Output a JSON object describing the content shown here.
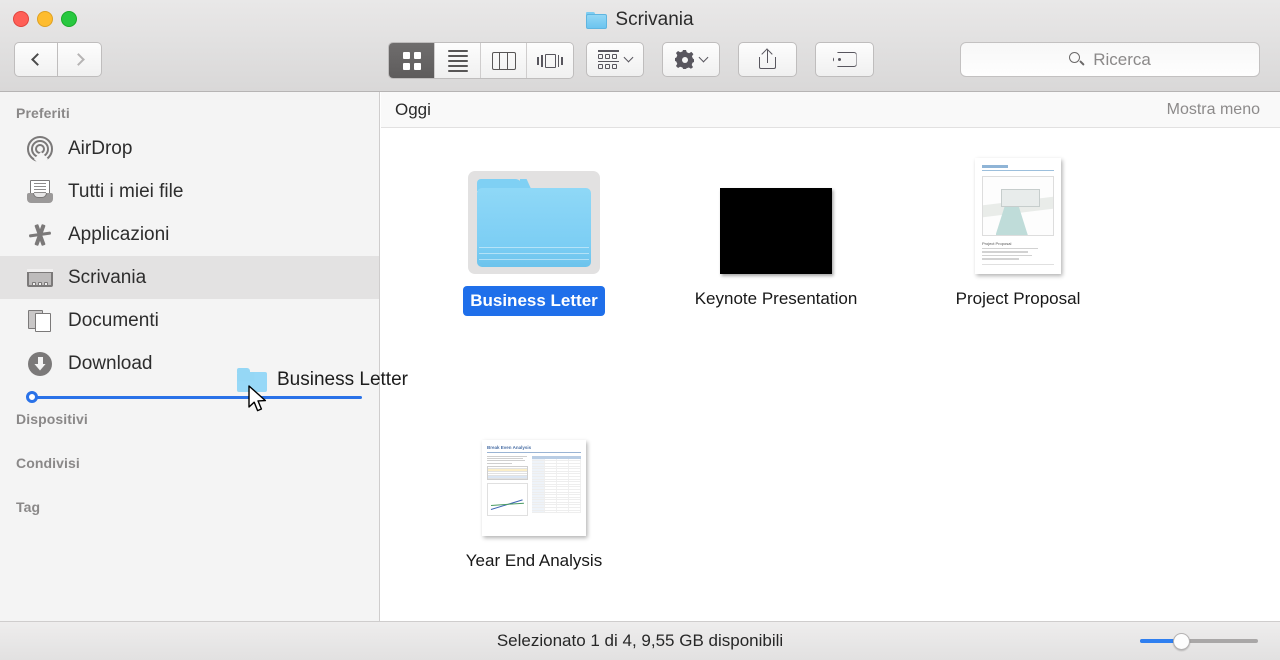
{
  "window": {
    "title": "Scrivania",
    "title_icon": "folder-icon",
    "traffic_lights": [
      {
        "name": "close",
        "color": "#ff5f57"
      },
      {
        "name": "minimize",
        "color": "#febc2e"
      },
      {
        "name": "maximize",
        "color": "#28c840"
      }
    ]
  },
  "toolbar": {
    "back_label": "Indietro",
    "forward_label": "Avanti",
    "view_buttons": [
      {
        "name": "icon-view",
        "icon": "grid-icon",
        "active": true
      },
      {
        "name": "list-view",
        "icon": "list-icon",
        "active": false
      },
      {
        "name": "column-view",
        "icon": "columns-icon",
        "active": false
      },
      {
        "name": "coverflow-view",
        "icon": "coverflow-icon",
        "active": false
      }
    ],
    "arrange_label": "Disponi",
    "action_label": "Azione",
    "share_label": "Condividi",
    "tag_label": "Tag"
  },
  "search": {
    "placeholder": "Ricerca",
    "value": "",
    "icon": "search-icon"
  },
  "sidebar": {
    "sections": [
      {
        "header": "Preferiti",
        "items": [
          {
            "label": "AirDrop",
            "icon": "airdrop-icon",
            "selected": false
          },
          {
            "label": "Tutti i miei file",
            "icon": "all-files-icon",
            "selected": false
          },
          {
            "label": "Applicazioni",
            "icon": "applications-icon",
            "selected": false
          },
          {
            "label": "Scrivania",
            "icon": "desktop-icon",
            "selected": true
          },
          {
            "label": "Documenti",
            "icon": "documents-icon",
            "selected": false
          },
          {
            "label": "Download",
            "icon": "downloads-icon",
            "selected": false
          }
        ]
      },
      {
        "header": "Dispositivi",
        "items": []
      },
      {
        "header": "Condivisi",
        "items": []
      },
      {
        "header": "Tag",
        "items": []
      }
    ]
  },
  "drag": {
    "label": "Business Letter",
    "icon": "folder-icon",
    "drop_indicator_color": "#2a72e8",
    "cursor": "arrow-cursor"
  },
  "content": {
    "group_title": "Oggi",
    "group_action": "Mostra meno",
    "items": [
      {
        "name": "Business Letter",
        "kind": "folder",
        "selected": true
      },
      {
        "name": "Keynote Presentation",
        "kind": "keynote",
        "selected": false
      },
      {
        "name": "Project Proposal",
        "kind": "document",
        "selected": false
      },
      {
        "name": "Year End Analysis",
        "kind": "spreadsheet",
        "selected": false
      }
    ]
  },
  "statusbar": {
    "text": "Selezionato 1 di 4, 9,55 GB disponibili",
    "zoom_percent": 38
  },
  "colors": {
    "accent": "#1f6fea",
    "drop_line": "#2a72e8",
    "folder_blue": "#7ccef4",
    "sidebar_bg": "#f4f4f4",
    "selected_row": "#e3e2e2"
  }
}
